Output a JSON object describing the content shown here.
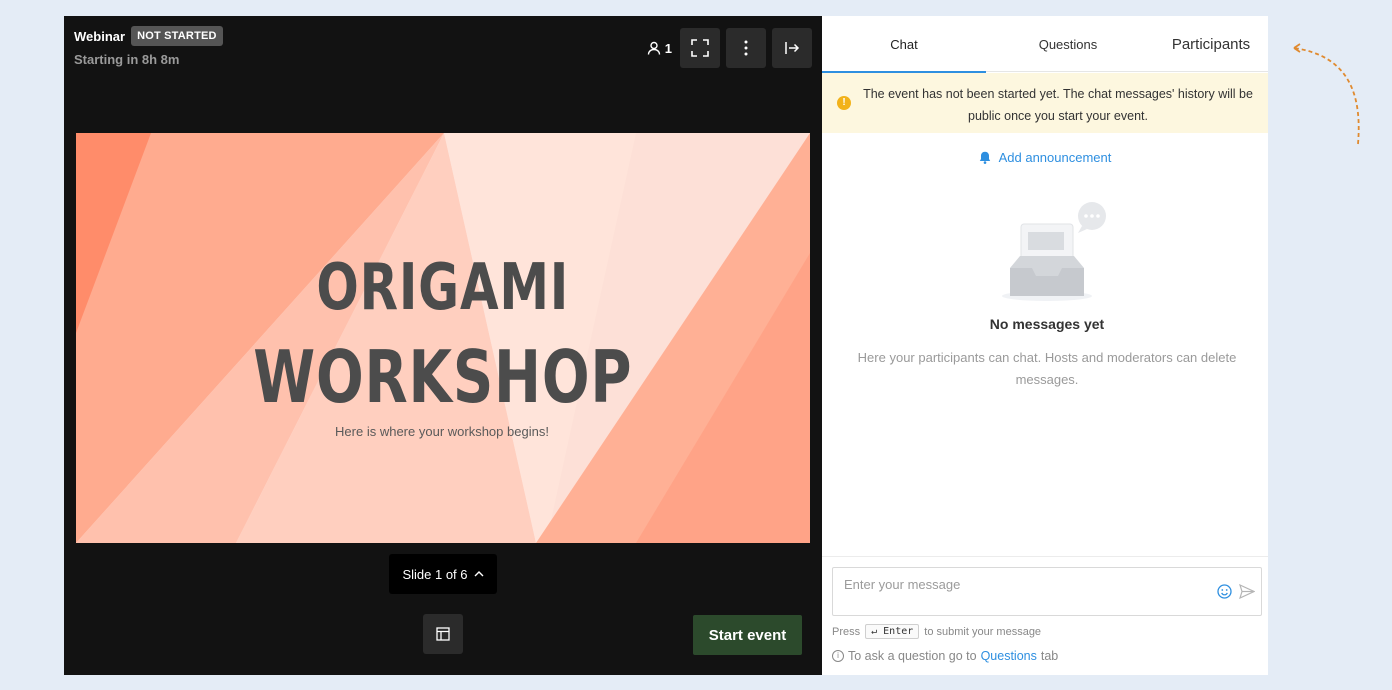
{
  "stage": {
    "title": "Webinar",
    "status_badge": "NOT STARTED",
    "countdown": "Starting in 8h 8m",
    "participant_count": "1",
    "icons": [
      "user-icon",
      "fullscreen-icon",
      "more-vertical-icon",
      "exit-icon"
    ]
  },
  "slide": {
    "title_line1": "ORIGAMI",
    "title_line2": "WORKSHOP",
    "subtitle": "Here is where your workshop begins!",
    "colors": {
      "base": "#fde0d7",
      "coral": "#ff8c6a",
      "salmon": "#ffab8f",
      "peach": "#ffc4b1",
      "dark_text": "#4c4c4c"
    }
  },
  "slide_nav": {
    "label": "Slide 1 of 6"
  },
  "actions": {
    "start_event": "Start event"
  },
  "panel": {
    "tabs": [
      {
        "label": "Chat",
        "active": true
      },
      {
        "label": "Questions",
        "active": false
      },
      {
        "label": "Participants",
        "active": false
      }
    ],
    "notice": "The event has not been started yet. The chat messages' history will be public once you start your event.",
    "add_announcement": "Add announcement",
    "empty_title": "No messages yet",
    "empty_desc": "Here your participants can chat. Hosts and moderators can delete messages.",
    "composer": {
      "placeholder": "Enter your message",
      "hint_press": "Press",
      "hint_key": "↵ Enter",
      "hint_suffix": "to submit your message",
      "ask_prefix": "To ask a question go to",
      "ask_link": "Questions",
      "ask_suffix": "tab"
    },
    "accent_color": "#2e8fe0"
  }
}
